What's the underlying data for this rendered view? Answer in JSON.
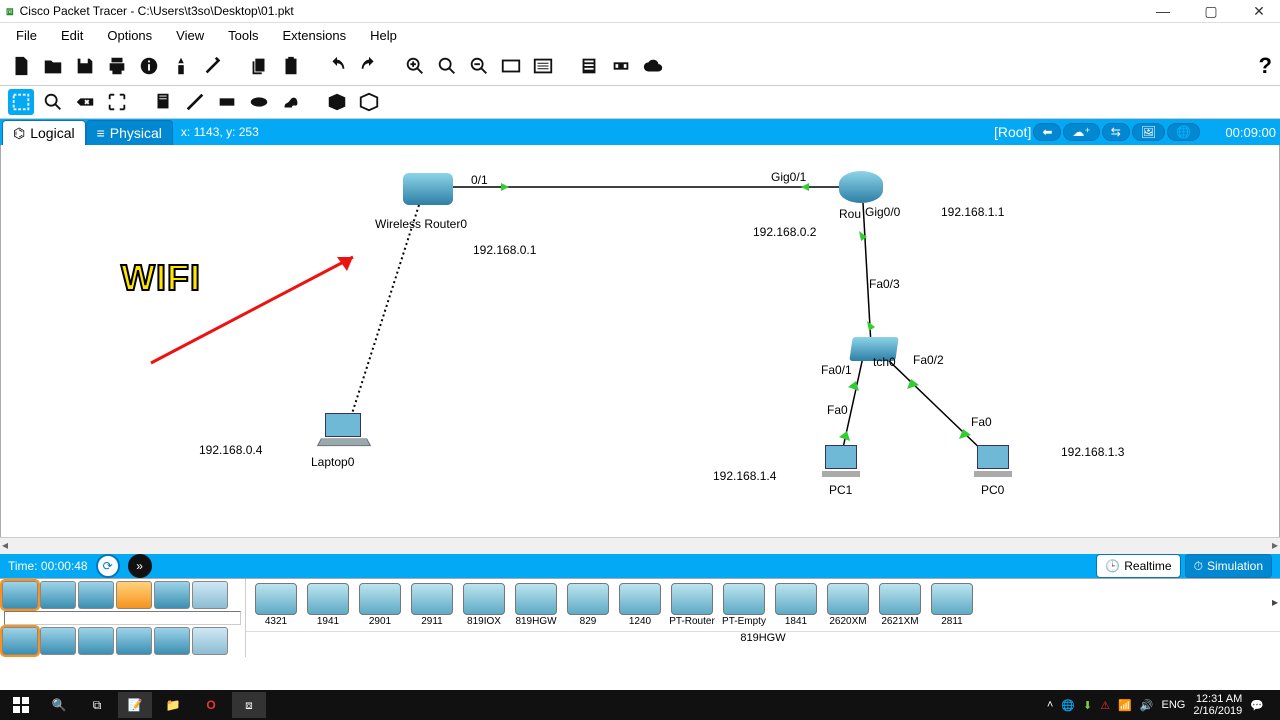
{
  "window": {
    "app": "Cisco Packet Tracer",
    "path": "C:\\Users\\t3so\\Desktop\\01.pkt",
    "title": "Cisco Packet Tracer - C:\\Users\\t3so\\Desktop\\01.pkt"
  },
  "menu": {
    "file": "File",
    "edit": "Edit",
    "options": "Options",
    "view": "View",
    "tools": "Tools",
    "extensions": "Extensions",
    "help": "Help"
  },
  "viewbar": {
    "logical": "Logical",
    "physical": "Physical",
    "coords": "x: 1143, y: 253",
    "root": "[Root]",
    "clock": "00:09:00"
  },
  "canvas": {
    "wifi_annotation": "WIFI",
    "devices": {
      "wireless_router": {
        "label": "Wireless Router0",
        "ip": "192.168.0.1"
      },
      "router": {
        "label": "Rou",
        "port1": "Gig0/1",
        "port2": "Gig0/0",
        "ip_left": "192.168.0.2",
        "ip_right": "192.168.1.1"
      },
      "switch": {
        "label": "tch0",
        "p1": "Fa0/1",
        "p2": "Fa0/2",
        "p3": "Fa0/3"
      },
      "laptop": {
        "label": "Laptop0",
        "ip": "192.168.0.4"
      },
      "pc0": {
        "label": "PC0",
        "ip": "192.168.1.3",
        "port": "Fa0"
      },
      "pc1": {
        "label": "PC1",
        "ip": "192.168.1.4",
        "port": "Fa0"
      }
    },
    "link_wr_port": "0/1"
  },
  "timebar": {
    "time_label": "Time: 00:00:48",
    "realtime": "Realtime",
    "simulation": "Simulation"
  },
  "palette": {
    "category_name": "",
    "items": [
      {
        "lbl": "4321"
      },
      {
        "lbl": "1941"
      },
      {
        "lbl": "2901"
      },
      {
        "lbl": "2911"
      },
      {
        "lbl": "819IOX"
      },
      {
        "lbl": "819HGW"
      },
      {
        "lbl": "829"
      },
      {
        "lbl": "1240"
      },
      {
        "lbl": "PT-Router"
      },
      {
        "lbl": "PT-Empty"
      },
      {
        "lbl": "1841"
      },
      {
        "lbl": "2620XM"
      },
      {
        "lbl": "2621XM"
      },
      {
        "lbl": "2811"
      }
    ],
    "selected": "819HGW"
  },
  "taskbar": {
    "lang": "ENG",
    "time": "12:31 AM",
    "date": "2/16/2019"
  }
}
